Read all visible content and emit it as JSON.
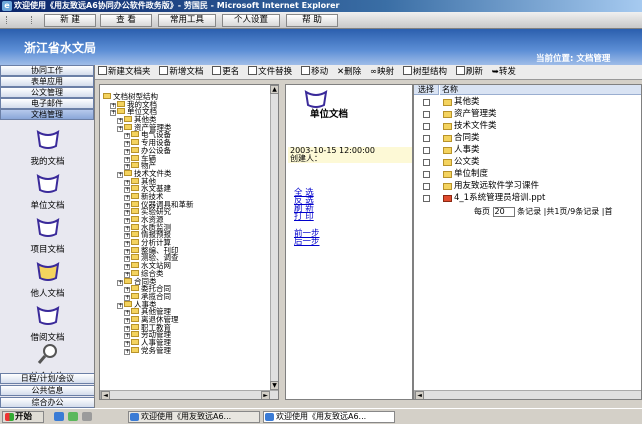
{
  "window": {
    "title": "欢迎使用《用友致远A6协同办公软件政务版》- 劳国民 - Microsoft Internet Explorer"
  },
  "menubar": {
    "items": [
      "新 建",
      "查 看",
      "常用工具",
      "个人设置",
      "帮 助"
    ]
  },
  "header": {
    "site_name": "浙江省水文局",
    "location_label": "当前位置:  文档管理"
  },
  "leftnav": {
    "top_tabs": [
      "协同工作",
      "表单应用",
      "公文管理",
      "电子邮件",
      "文档管理"
    ],
    "icons": [
      "我的文档",
      "单位文档",
      "项目文档",
      "他人文档",
      "借阅文档",
      "综合查询"
    ],
    "bottom_tabs": [
      "日程/计划/会议",
      "公共信息",
      "综合办公"
    ]
  },
  "toolbar": {
    "buttons": [
      "新建文档夹",
      "新增文档",
      "更名",
      "文件替换",
      "移动",
      "删除",
      "映射",
      "树型结构",
      "刷新",
      "转发"
    ]
  },
  "tree": {
    "root": "文档树型结构",
    "nodes": [
      {
        "label": "我的文档",
        "level": 1
      },
      {
        "label": "单位文档",
        "level": 1
      },
      {
        "label": "其他类",
        "level": 2
      },
      {
        "label": "资产管理类",
        "level": 2
      },
      {
        "label": "电气设备",
        "level": 3
      },
      {
        "label": "专用设备",
        "level": 3
      },
      {
        "label": "办公设备",
        "level": 3
      },
      {
        "label": "车辆",
        "level": 3
      },
      {
        "label": "物产",
        "level": 3
      },
      {
        "label": "技术文件类",
        "level": 2
      },
      {
        "label": "其他",
        "level": 3
      },
      {
        "label": "水文基建",
        "level": 3
      },
      {
        "label": "新技术",
        "level": 3
      },
      {
        "label": "仪器调具和革新",
        "level": 3
      },
      {
        "label": "实验研究",
        "level": 3
      },
      {
        "label": "水资源",
        "level": 3
      },
      {
        "label": "水质监测",
        "level": 3
      },
      {
        "label": "情报预报",
        "level": 3
      },
      {
        "label": "分析计算",
        "level": 3
      },
      {
        "label": "整编、刊印",
        "level": 3
      },
      {
        "label": "测验、调查",
        "level": 3
      },
      {
        "label": "水文站网",
        "level": 3
      },
      {
        "label": "综合类",
        "level": 3
      },
      {
        "label": "合同类",
        "level": 2
      },
      {
        "label": "委托合同",
        "level": 3
      },
      {
        "label": "承揽合同",
        "level": 3
      },
      {
        "label": "人事类",
        "level": 2
      },
      {
        "label": "其他管理",
        "level": 3
      },
      {
        "label": "离退休管理",
        "level": 3
      },
      {
        "label": "职工教育",
        "level": 3
      },
      {
        "label": "劳动管理",
        "level": 3
      },
      {
        "label": "人事管理",
        "level": 3
      },
      {
        "label": "党务管理",
        "level": 3
      }
    ]
  },
  "detail": {
    "folder_title": "单位文档",
    "created": "2003-10-15 12:00:00",
    "creator_label": "创建人：",
    "links": [
      "全 选",
      "反 选",
      "刷 新",
      "打 印"
    ],
    "nav_links": [
      "前一步",
      "后一步"
    ]
  },
  "list": {
    "columns": [
      "选择",
      "名称"
    ],
    "rows": [
      {
        "name": "其他类",
        "type": "folder"
      },
      {
        "name": "资产管理类",
        "type": "folder"
      },
      {
        "name": "技术文件类",
        "type": "folder"
      },
      {
        "name": "合同类",
        "type": "folder"
      },
      {
        "name": "人事类",
        "type": "folder"
      },
      {
        "name": "公文类",
        "type": "folder"
      },
      {
        "name": "单位制度",
        "type": "folder"
      },
      {
        "name": "用友致远软件学习课件",
        "type": "folder"
      },
      {
        "name": "4_1系统管理员培训.ppt",
        "type": "ppt"
      }
    ],
    "pager": {
      "prefix": "每页",
      "per_page": "20",
      "suffix": "条记录 |共1页/9条记录 |首"
    }
  },
  "taskbar": {
    "start": "开始",
    "tasks": [
      "欢迎使用《用友致远A6...",
      "欢迎使用《用友致远A6..."
    ]
  },
  "colors": {
    "header": "#2b5fae",
    "folder": "#f4d35e",
    "link": "#0000cc"
  }
}
